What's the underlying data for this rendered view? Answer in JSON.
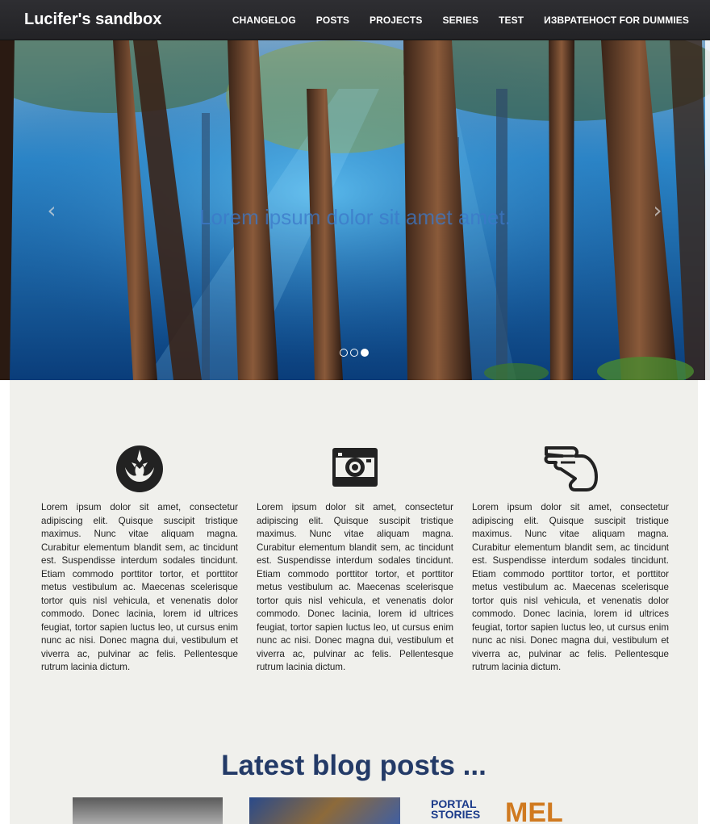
{
  "navbar": {
    "brand": "Lucifer's sandbox",
    "links": [
      "CHANGELOG",
      "POSTS",
      "PROJECTS",
      "SERIES",
      "TEST",
      "ИЗВРАТЕНОСТ FOR DUMMIES"
    ]
  },
  "carousel": {
    "caption": "Lorem ipsum dolor sit amet amet.",
    "prev_icon": "chevron-left-icon",
    "next_icon": "chevron-right-icon",
    "slide_count": 3,
    "active_slide": 3
  },
  "features": [
    {
      "icon": "rebel-alliance-icon",
      "text": "Lorem ipsum dolor sit amet, consectetur adipiscing elit. Quisque suscipit tristique maximus. Nunc vitae aliquam magna. Curabitur elementum blandit sem, ac tincidunt est. Suspendisse interdum sodales tincidunt. Etiam commodo porttitor tortor, et porttitor metus vestibulum ac. Maecenas scelerisque tortor quis nisl vehicula, et venenatis dolor commodo. Donec lacinia, lorem id ultrices feugiat, tortor sapien luctus leo, ut cursus enim nunc ac nisi. Donec magna dui, vestibulum et viverra ac, pulvinar ac felis. Pellentesque rutrum lacinia dictum."
    },
    {
      "icon": "camera-icon",
      "text": "Lorem ipsum dolor sit amet, consectetur adipiscing elit. Quisque suscipit tristique maximus. Nunc vitae aliquam magna. Curabitur elementum blandit sem, ac tincidunt est. Suspendisse interdum sodales tincidunt. Etiam commodo porttitor tortor, et porttitor metus vestibulum ac. Maecenas scelerisque tortor quis nisl vehicula, et venenatis dolor commodo. Donec lacinia, lorem id ultrices feugiat, tortor sapien luctus leo, ut cursus enim nunc ac nisi. Donec magna dui, vestibulum et viverra ac, pulvinar ac felis. Pellentesque rutrum lacinia dictum."
    },
    {
      "icon": "hand-icon",
      "text": "Lorem ipsum dolor sit amet, consectetur adipiscing elit. Quisque suscipit tristique maximus. Nunc vitae aliquam magna. Curabitur elementum blandit sem, ac tincidunt est. Suspendisse interdum sodales tincidunt. Etiam commodo porttitor tortor, et porttitor metus vestibulum ac. Maecenas scelerisque tortor quis nisl vehicula, et venenatis dolor commodo. Donec lacinia, lorem id ultrices feugiat, tortor sapien luctus leo, ut cursus enim nunc ac nisi. Donec magna dui, vestibulum et viverra ac, pulvinar ac felis. Pellentesque rutrum lacinia dictum."
    }
  ],
  "blog": {
    "title": "Latest blog posts ...",
    "thumb3_text_line1": "PORTAL",
    "thumb3_text_line2": "STORIES",
    "thumb3_text_big": "MEL"
  },
  "colors": {
    "navbar": "#2a2a2e",
    "main_bg": "#f0f0ec",
    "title": "#233a67"
  }
}
